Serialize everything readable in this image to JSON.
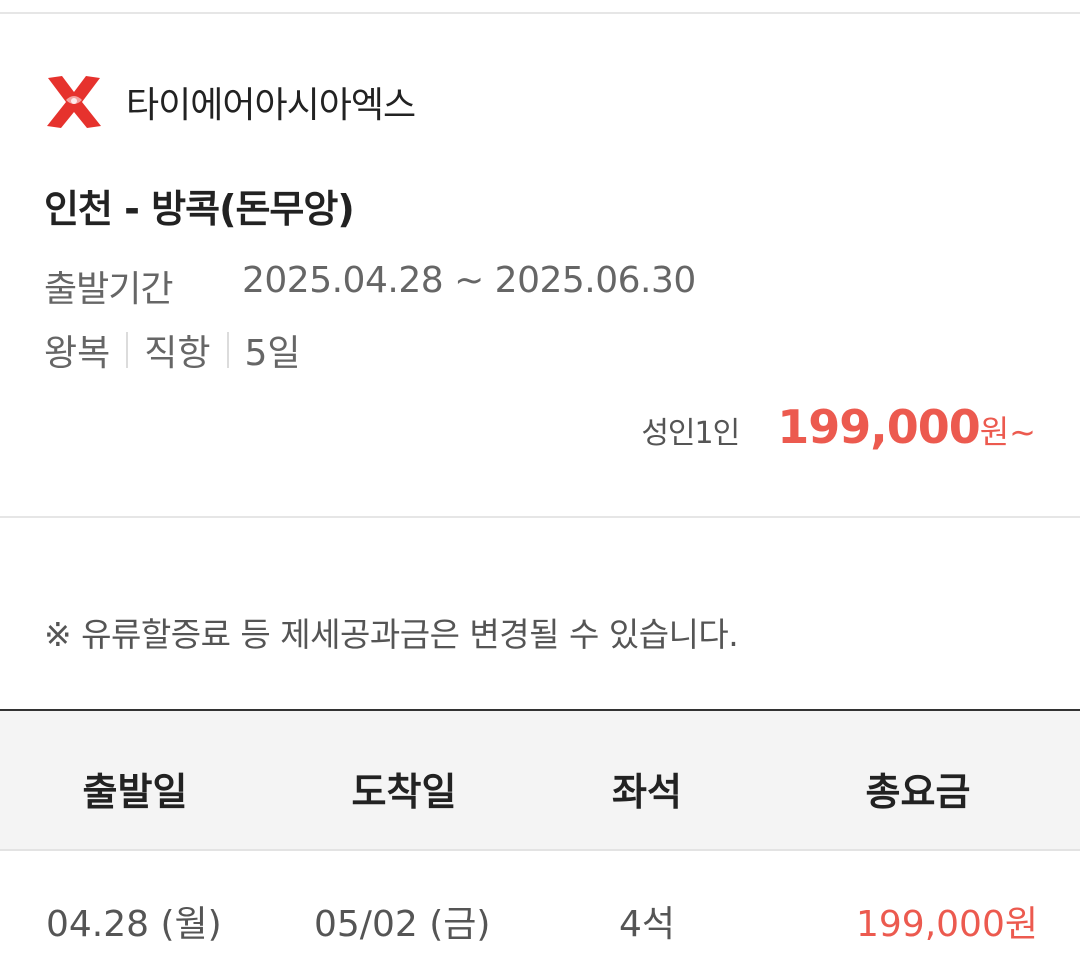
{
  "airline": {
    "name": "타이에어아시아엑스",
    "logo_icon": "airasia-x-logo-icon",
    "logo_color": "#e6322d"
  },
  "route": {
    "title": "인천 - 방콕(돈무앙)"
  },
  "period": {
    "label": "출발기간",
    "value": "2025.04.28 ~ 2025.06.30"
  },
  "tags": [
    "왕복",
    "직항",
    "5일"
  ],
  "price": {
    "person": "성인1인",
    "amount": "199,000",
    "unit": "원~",
    "color": "#ec5a4f"
  },
  "notice": "※ 유류할증료 등 제세공과금은 변경될 수 있습니다.",
  "table": {
    "headers": [
      "출발일",
      "도착일",
      "좌석",
      "총요금"
    ],
    "rows": [
      {
        "departure": "04.28 (월)",
        "arrival": "05/02 (금)",
        "seats": "4석",
        "total": "199,000원"
      }
    ]
  }
}
